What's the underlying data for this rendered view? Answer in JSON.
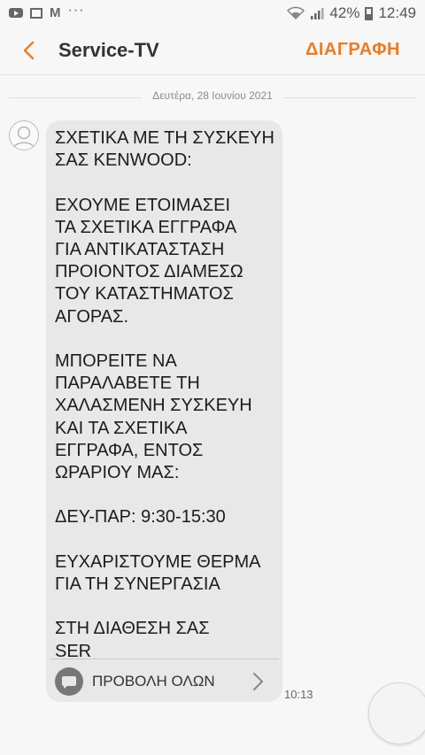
{
  "status_bar": {
    "battery": "42%",
    "time": "12:49",
    "icons": [
      "youtube-icon",
      "news-icon",
      "gmail-icon",
      "more-dots-icon",
      "wifi-icon",
      "signal-icon",
      "battery-icon"
    ]
  },
  "header": {
    "title": "Service-TV",
    "delete_label": "ΔΙΑΓΡΑΦΗ",
    "accent_color": "#e87d28"
  },
  "conversation": {
    "date": "Δευτέρα, 28 Ιουνίου 2021",
    "message": {
      "text": "ΣΧΕΤΙΚΑ ΜΕ ΤΗ ΣΥΣΚΕΥΗ\nΣΑΣ KENWOOD:\n\nΕΧΟΥΜΕ ΕΤΟΙΜΑΣΕΙ\nΤΑ ΣΧΕΤΙΚΑ ΕΓΓΡΑΦΑ\nΓΙΑ ΑΝΤΙΚΑΤΑΣΤΑΣΗ\nΠΡΟΙΟΝΤΟΣ ΔΙΑΜΕΣΩ\nΤΟΥ ΚΑΤΑΣΤΗΜΑΤΟΣ\nΑΓΟΡΑΣ.\n\nΜΠΟΡΕΙΤΕ ΝΑ\nΠΑΡΑΛΑΒΕΤΕ ΤΗ\nΧΑΛΑΣΜΕΝΗ ΣΥΣΚΕΥΗ\nΚΑΙ ΤΑ ΣΧΕΤΙΚΑ\nΕΓΓΡΑΦΑ, ΕΝΤΟΣ\nΩΡΑΡΙΟΥ ΜΑΣ:\n\nΔΕΥ-ΠΑΡ: 9:30-15:30\n\nΕΥΧΑΡΙΣΤΟΥΜΕ ΘΕΡΜΑ\nΓΙΑ ΤΗ ΣΥΝΕΡΓΑΣΙΑ\n\nΣΤΗ ΔΙΑΘΕΣΗ ΣΑΣ\nSER",
      "view_all_label": "ΠΡΟΒΟΛΗ ΟΛΩΝ",
      "time": "10:13"
    }
  }
}
